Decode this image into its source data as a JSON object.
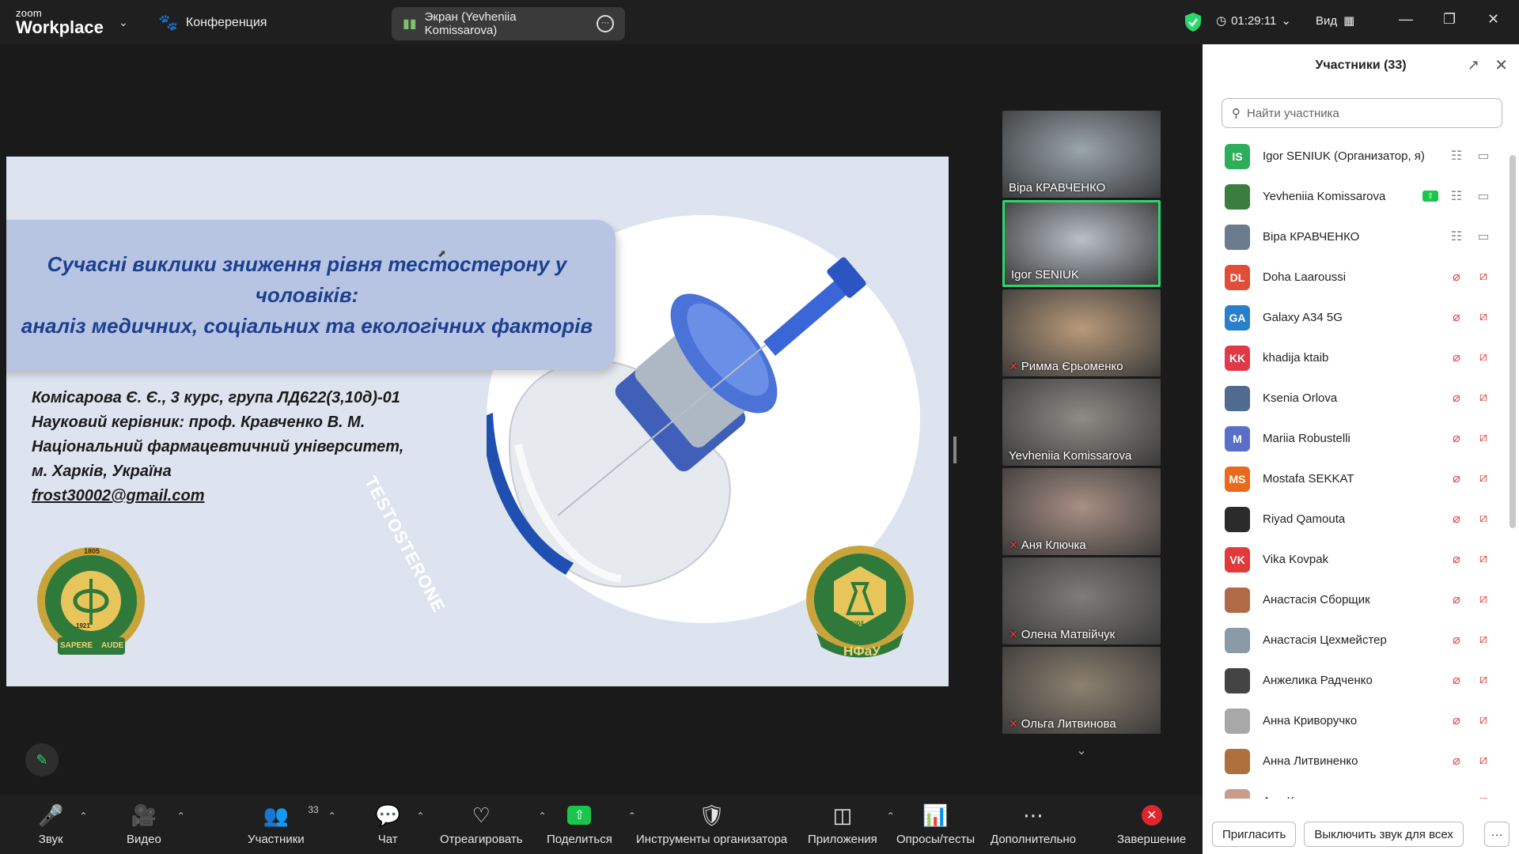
{
  "topbar": {
    "brand_small": "zoom",
    "brand_large": "Workplace",
    "meeting_label": "Конференция",
    "share_label": "Экран (Yevheniia Komissarova)",
    "timer": "01:29:11",
    "view_label": "Вид"
  },
  "slide": {
    "title_line1": "Сучасні виклики зниження рівня тестостерону у чоловіків:",
    "title_line2": "аналіз медичних, соціальних та екологічних факторів",
    "author_line1": "Комісарова Є. Є., 3 курс, група ЛД622(3,10д)-01",
    "author_line2": "Науковий керівник: проф. Кравченко В. М.",
    "author_line3": "Національний фармацевтичний університет, м. Харків, Україна",
    "email": "frost30002@gmail.com",
    "vial_label": "TESTOSTERONE",
    "logo_left_year": "1805",
    "logo_left_motto_1": "SAPERE",
    "logo_left_motto_2": "AUDE",
    "logo_left_founded": "1921",
    "logo_right_text": "НФаУ",
    "logo_right_year": "2004"
  },
  "gallery": [
    {
      "name": "Віра КРАВЧЕНКО",
      "muted": false,
      "active": false,
      "bg": "#9aa5ad"
    },
    {
      "name": "Igor SENIUK",
      "muted": false,
      "active": true,
      "bg": "#b9c0c8"
    },
    {
      "name": "Римма Єрьоменко",
      "muted": true,
      "active": false,
      "bg": "#b89a7a"
    },
    {
      "name": "Yevheniia Komissarova",
      "muted": false,
      "active": false,
      "bg": "#8f8b86"
    },
    {
      "name": "Аня Ключка",
      "muted": true,
      "active": false,
      "bg": "#a88f84"
    },
    {
      "name": "Олена Матвійчук",
      "muted": true,
      "active": false,
      "bg": "#7f7c7a"
    },
    {
      "name": "Ольга Литвинова",
      "muted": true,
      "active": false,
      "bg": "#8d8170"
    }
  ],
  "toolbar": {
    "audio": "Звук",
    "video": "Видео",
    "participants": "Участники",
    "participants_count": "33",
    "chat": "Чат",
    "react": "Отреагировать",
    "share": "Поделиться",
    "host_tools": "Инструменты организатора",
    "apps": "Приложения",
    "polls": "Опросы/тесты",
    "more": "Дополнительно",
    "end": "Завершение"
  },
  "panel": {
    "title": "Участники (33)",
    "search_placeholder": "Найти участника",
    "invite": "Пригласить",
    "mute_all": "Выключить звук для всех",
    "more": "···",
    "participants": [
      {
        "initials": "IS",
        "color": "#2eae5a",
        "name": "Igor SENIUK (Организатор, я)",
        "state": "on"
      },
      {
        "initials": "",
        "color": "#3b7d3f",
        "name": "Yevheniia Komissarova",
        "state": "sharing"
      },
      {
        "initials": "",
        "color": "#6b7a8c",
        "name": "Віра КРАВЧЕНКО",
        "state": "on"
      },
      {
        "initials": "DL",
        "color": "#e04e39",
        "name": "Doha Laaroussi",
        "state": "muted"
      },
      {
        "initials": "GA",
        "color": "#2a7fc9",
        "name": "Galaxy A34 5G",
        "state": "muted"
      },
      {
        "initials": "KK",
        "color": "#e03a4a",
        "name": "khadija ktaib",
        "state": "muted"
      },
      {
        "initials": "",
        "color": "#4f6b8f",
        "name": "Ksenia Orlova",
        "state": "muted"
      },
      {
        "initials": "M",
        "color": "#5a6fc8",
        "name": "Mariia Robustelli",
        "state": "muted"
      },
      {
        "initials": "MS",
        "color": "#e96a1c",
        "name": "Mostafa SEKKAT",
        "state": "muted"
      },
      {
        "initials": "",
        "color": "#2b2b2b",
        "name": "Riyad Qamouta",
        "state": "muted"
      },
      {
        "initials": "VK",
        "color": "#e03a3a",
        "name": "Vika Kovpak",
        "state": "muted"
      },
      {
        "initials": "",
        "color": "#b06a46",
        "name": "Анастасія Сборщик",
        "state": "muted"
      },
      {
        "initials": "",
        "color": "#8a9aa6",
        "name": "Анастасія Цехмейстер",
        "state": "muted"
      },
      {
        "initials": "",
        "color": "#444444",
        "name": "Анжелика Радченко",
        "state": "muted"
      },
      {
        "initials": "",
        "color": "#a8a8a8",
        "name": "Анна Криворучко",
        "state": "muted"
      },
      {
        "initials": "",
        "color": "#b0703e",
        "name": "Анна Литвиненко",
        "state": "muted"
      },
      {
        "initials": "",
        "color": "#c79c8a",
        "name": "Аня Ключка",
        "state": "muted"
      }
    ]
  },
  "colors": {
    "accent_green": "#19c54a",
    "end_red": "#e0262d",
    "mute_red": "#e24141",
    "slide_title": "#1d3f8f"
  }
}
